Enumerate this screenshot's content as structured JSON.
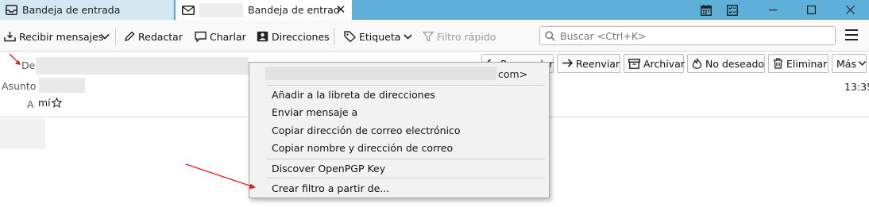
{
  "tabs": [
    {
      "label": "Bandeja de entrada",
      "icon": "inbox-icon"
    },
    {
      "label": "Bandeja de entrad",
      "icon": "envelope-icon"
    }
  ],
  "window": {
    "calendar_icon": "calendar-icon",
    "tasks_icon": "tasks-icon"
  },
  "toolbar": {
    "get_messages": "Recibir mensajes",
    "compose": "Redactar",
    "chat": "Charlar",
    "address_book": "Direcciones",
    "tag": "Etiqueta",
    "quick_filter": "Filtro rápido",
    "search_placeholder": "Buscar <Ctrl+K>"
  },
  "header": {
    "from_label": "De",
    "subject_label": "Asunto",
    "to_label": "A",
    "to_value": "mí",
    "time": "13:35",
    "buttons": {
      "reply": "Responder",
      "forward": "Reenviar",
      "archive": "Archivar",
      "junk": "No deseado",
      "delete": "Eliminar",
      "more": "Más"
    }
  },
  "context_menu": {
    "address_suffix": "com>",
    "items": {
      "add_to_address_book": "Añadir a la libreta de direcciones",
      "compose_to": "Enviar mensaje a",
      "copy_email": "Copiar dirección de correo electrónico",
      "copy_name_email": "Copiar nombre y dirección de correo",
      "discover_openpgp": "Discover OpenPGP Key",
      "create_filter": "Crear filtro a partir de..."
    }
  },
  "colors": {
    "titlebar": "#5fb0d8",
    "annotation_arrow": "#e21b1b"
  }
}
